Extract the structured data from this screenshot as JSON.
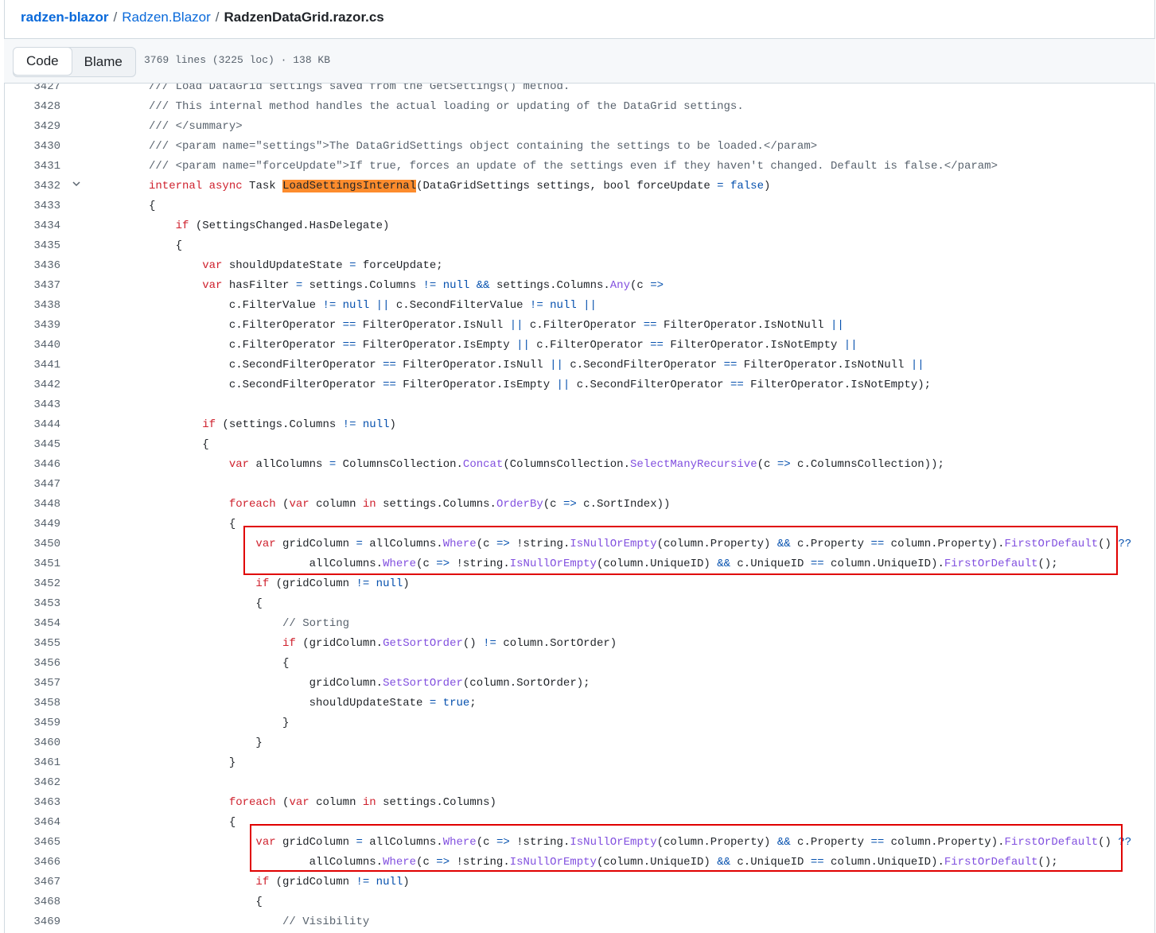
{
  "breadcrumb": {
    "repo": "radzen-blazor",
    "dir": "Radzen.Blazor",
    "file": "RadzenDataGrid.razor.cs",
    "separator": "/"
  },
  "toolbar": {
    "code_label": "Code",
    "blame_label": "Blame",
    "file_info": "3769 lines (3225 loc) · 138 KB"
  },
  "code": {
    "highlighted_identifier": "LoadSettingsInternal",
    "lines": [
      {
        "n": "3427",
        "t": "    /// Load DataGrid settings saved from the GetSettings() method."
      },
      {
        "n": "3428",
        "t": "    /// This internal method handles the actual loading or updating of the DataGrid settings."
      },
      {
        "n": "3429",
        "t": "    /// </summary>"
      },
      {
        "n": "3430",
        "t": "    /// <param name=\"settings\">The DataGridSettings object containing the settings to be loaded.</param>"
      },
      {
        "n": "3431",
        "t": "    /// <param name=\"forceUpdate\">If true, forces an update of the settings even if they haven't changed. Default is false.</param>"
      },
      {
        "n": "3432",
        "t": "    internal async Task LoadSettingsInternal(DataGridSettings settings, bool forceUpdate = false)"
      },
      {
        "n": "3433",
        "t": "    {"
      },
      {
        "n": "3434",
        "t": "        if (SettingsChanged.HasDelegate)"
      },
      {
        "n": "3435",
        "t": "        {"
      },
      {
        "n": "3436",
        "t": "            var shouldUpdateState = forceUpdate;"
      },
      {
        "n": "3437",
        "t": "            var hasFilter = settings.Columns != null && settings.Columns.Any(c =>"
      },
      {
        "n": "3438",
        "t": "                c.FilterValue != null || c.SecondFilterValue != null ||"
      },
      {
        "n": "3439",
        "t": "                c.FilterOperator == FilterOperator.IsNull || c.FilterOperator == FilterOperator.IsNotNull ||"
      },
      {
        "n": "3440",
        "t": "                c.FilterOperator == FilterOperator.IsEmpty || c.FilterOperator == FilterOperator.IsNotEmpty ||"
      },
      {
        "n": "3441",
        "t": "                c.SecondFilterOperator == FilterOperator.IsNull || c.SecondFilterOperator == FilterOperator.IsNotNull ||"
      },
      {
        "n": "3442",
        "t": "                c.SecondFilterOperator == FilterOperator.IsEmpty || c.SecondFilterOperator == FilterOperator.IsNotEmpty);"
      },
      {
        "n": "3443",
        "t": ""
      },
      {
        "n": "3444",
        "t": "            if (settings.Columns != null)"
      },
      {
        "n": "3445",
        "t": "            {"
      },
      {
        "n": "3446",
        "t": "                var allColumns = ColumnsCollection.Concat(ColumnsCollection.SelectManyRecursive(c => c.ColumnsCollection));"
      },
      {
        "n": "3447",
        "t": ""
      },
      {
        "n": "3448",
        "t": "                foreach (var column in settings.Columns.OrderBy(c => c.SortIndex))"
      },
      {
        "n": "3449",
        "t": "                {"
      },
      {
        "n": "3450",
        "t": "                    var gridColumn = allColumns.Where(c => !string.IsNullOrEmpty(column.Property) && c.Property == column.Property).FirstOrDefault() ??"
      },
      {
        "n": "3451",
        "t": "                            allColumns.Where(c => !string.IsNullOrEmpty(column.UniqueID) && c.UniqueID == column.UniqueID).FirstOrDefault();"
      },
      {
        "n": "3452",
        "t": "                    if (gridColumn != null)"
      },
      {
        "n": "3453",
        "t": "                    {"
      },
      {
        "n": "3454",
        "t": "                        // Sorting"
      },
      {
        "n": "3455",
        "t": "                        if (gridColumn.GetSortOrder() != column.SortOrder)"
      },
      {
        "n": "3456",
        "t": "                        {"
      },
      {
        "n": "3457",
        "t": "                            gridColumn.SetSortOrder(column.SortOrder);"
      },
      {
        "n": "3458",
        "t": "                            shouldUpdateState = true;"
      },
      {
        "n": "3459",
        "t": "                        }"
      },
      {
        "n": "3460",
        "t": "                    }"
      },
      {
        "n": "3461",
        "t": "                }"
      },
      {
        "n": "3462",
        "t": ""
      },
      {
        "n": "3463",
        "t": "                foreach (var column in settings.Columns)"
      },
      {
        "n": "3464",
        "t": "                {"
      },
      {
        "n": "3465",
        "t": "                    var gridColumn = allColumns.Where(c => !string.IsNullOrEmpty(column.Property) && c.Property == column.Property).FirstOrDefault() ??"
      },
      {
        "n": "3466",
        "t": "                            allColumns.Where(c => !string.IsNullOrEmpty(column.UniqueID) && c.UniqueID == column.UniqueID).FirstOrDefault();"
      },
      {
        "n": "3467",
        "t": "                    if (gridColumn != null)"
      },
      {
        "n": "3468",
        "t": "                    {"
      },
      {
        "n": "3469",
        "t": "                        // Visibility"
      }
    ]
  },
  "colors": {
    "keyword": "#cf222e",
    "literal": "#0550ae",
    "method": "#8250df",
    "comment": "#59636e",
    "highlight": "#fd8c2d",
    "annotation_box": "#e00000"
  }
}
